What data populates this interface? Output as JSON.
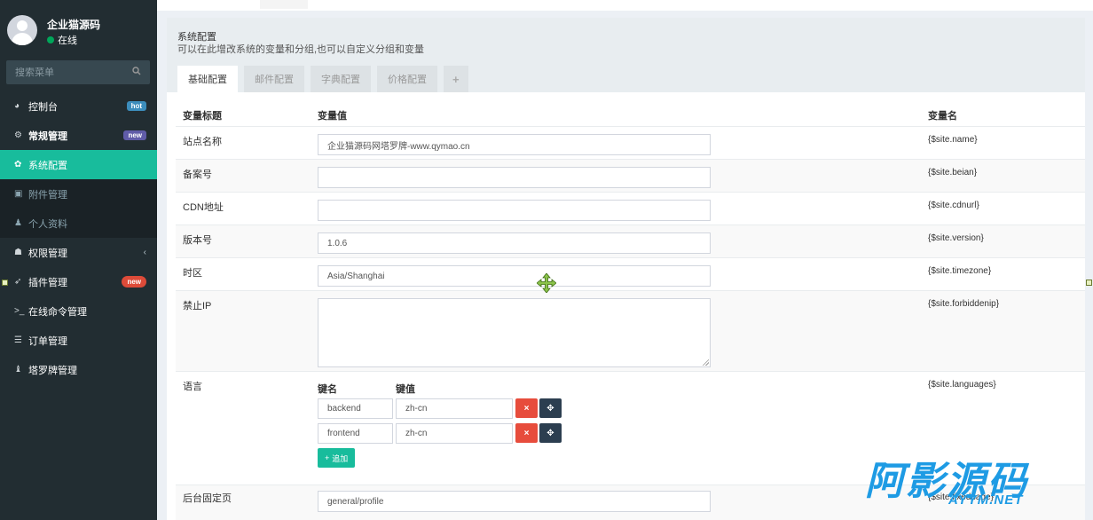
{
  "user": {
    "name": "企业猫源码",
    "status": "在线"
  },
  "search": {
    "placeholder": "搜索菜单"
  },
  "menu": [
    {
      "icon": "dashboard-icon",
      "label": "控制台",
      "badge": "hot"
    },
    {
      "icon": "cogs-icon",
      "label": "常规管理",
      "badge": "new"
    },
    {
      "icon": "gear-icon",
      "label": "系统配置"
    },
    {
      "icon": "file-image-icon",
      "label": "附件管理"
    },
    {
      "icon": "user-icon",
      "label": "个人资料"
    },
    {
      "icon": "group-icon",
      "label": "权限管理",
      "chevron": "‹"
    },
    {
      "icon": "rocket-icon",
      "label": "插件管理",
      "badge": "new"
    },
    {
      "icon": "terminal-icon",
      "label": "在线命令管理"
    },
    {
      "icon": "list-icon",
      "label": "订单管理"
    },
    {
      "icon": "chess-icon",
      "label": "塔罗牌管理"
    }
  ],
  "panel": {
    "title": "系统配置",
    "description": "可以在此增改系统的变量和分组,也可以自定义分组和变量",
    "tabs": [
      "基础配置",
      "邮件配置",
      "字典配置",
      "价格配置"
    ],
    "add_tab": "+"
  },
  "table": {
    "headers": {
      "title": "变量标题",
      "value": "变量值",
      "name": "变量名"
    },
    "rows": [
      {
        "label": "站点名称",
        "value": "企业猫源码网塔罗牌-www.qymao.cn",
        "var": "{$site.name}"
      },
      {
        "label": "备案号",
        "value": "",
        "var": "{$site.beian}"
      },
      {
        "label": "CDN地址",
        "value": "",
        "var": "{$site.cdnurl}"
      },
      {
        "label": "版本号",
        "value": "1.0.6",
        "var": "{$site.version}"
      },
      {
        "label": "时区",
        "value": "Asia/Shanghai",
        "var": "{$site.timezone}"
      },
      {
        "label": "禁止IP",
        "value": "",
        "var": "{$site.forbiddenip}"
      },
      {
        "label": "语言",
        "var": "{$site.languages}"
      },
      {
        "label": "后台固定页",
        "value": "general/profile",
        "var": "{$site.fixedpage}"
      }
    ],
    "languages": {
      "key_header": "键名",
      "value_header": "键值",
      "pairs": [
        {
          "key": "backend",
          "value": "zh-cn"
        },
        {
          "key": "frontend",
          "value": "zh-cn"
        }
      ],
      "delete_label": "×",
      "move_label": "✥",
      "add_label": "追加",
      "add_icon": "+"
    }
  },
  "watermark": {
    "main": "阿影源码",
    "sub": "AYYM.NET"
  },
  "colors": {
    "sidebar": "#222d32",
    "accent": "#18bc9c",
    "danger": "#e74c3c",
    "dark": "#2c3e50",
    "watermark": "#1e9be4"
  }
}
